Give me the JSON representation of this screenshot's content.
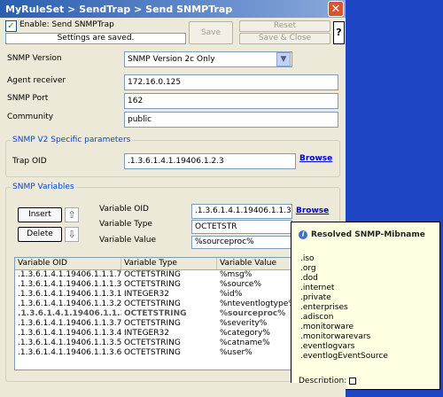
{
  "window": {
    "title": "MyRuleSet > SendTrap > Send SNMPTrap",
    "close_glyph": "✕"
  },
  "toolbar": {
    "enable_label": "Enable: Send SNMPTrap",
    "status": "Settings are saved.",
    "save_label": "Save",
    "reset_label": "Reset",
    "save_close_label": "Save & Close",
    "help_glyph": "?"
  },
  "form": {
    "version_label": "SNMP Version",
    "version_value": "SNMP Version 2c Only",
    "agent_label": "Agent receiver",
    "agent_value": "172.16.0.125",
    "port_label": "SNMP Port",
    "port_value": "162",
    "community_label": "Community",
    "community_value": "public"
  },
  "v2": {
    "group_title": "SNMP V2 Specific parameters",
    "trap_oid_label": "Trap OID",
    "trap_oid_value": ".1.3.6.1.4.1.19406.1.2.3",
    "browse_label": "Browse"
  },
  "variables": {
    "group_title": "SNMP Variables",
    "insert_label": "Insert",
    "delete_label": "Delete",
    "up_glyph": "⇧",
    "down_glyph": "⇩",
    "oid_label": "Variable OID",
    "oid_value": ".1.3.6.1.4.1.19406.1.1.3.3",
    "browse_label": "Browse",
    "type_label": "Variable Type",
    "type_value": "OCTETSTR",
    "value_label": "Variable Value",
    "value_value": "%sourceproc%"
  },
  "table": {
    "headers": [
      "Variable OID",
      "Variable Type",
      "Variable Value"
    ],
    "rows": [
      [
        ".1.3.6.1.4.1.19406.1.1.1.7",
        "OCTETSTRING",
        "%msg%"
      ],
      [
        ".1.3.6.1.4.1.19406.1.1.1.3",
        "OCTETSTRING",
        "%source%"
      ],
      [
        ".1.3.6.1.4.1.19406.1.1.3.1",
        "INTEGER32",
        "%id%"
      ],
      [
        ".1.3.6.1.4.1.19406.1.1.3.2",
        "OCTETSTRING",
        "%nteventlogtype%"
      ],
      [
        ".1.3.6.1.4.1.19406.1.1.3.3",
        "OCTETSTRING",
        "%sourceproc%"
      ],
      [
        ".1.3.6.1.4.1.19406.1.1.3.7",
        "OCTETSTRING",
        "%severity%"
      ],
      [
        ".1.3.6.1.4.1.19406.1.1.3.4",
        "INTEGER32",
        "%category%"
      ],
      [
        ".1.3.6.1.4.1.19406.1.1.3.5",
        "OCTETSTRING",
        "%catname%"
      ],
      [
        ".1.3.6.1.4.1.19406.1.1.3.6",
        "OCTETSTRING",
        "%user%"
      ]
    ],
    "selected_row": 4
  },
  "tooltip": {
    "title": "Resolved SNMP-Mibname",
    "icon": "info-icon",
    "items": [
      ".iso",
      ".org",
      ".dod",
      ".internet",
      ".private",
      ".enterprises",
      ".adiscon",
      ".monitorware",
      ".monitorwarevars",
      ".eventlogvars",
      ".eventlogEventSource"
    ],
    "description_label": "Description:"
  },
  "colors": {
    "titlebar": "#2a5fb0",
    "group_title": "#0046d5",
    "link": "#0000cc",
    "tooltip_bg": "#ffffe1"
  }
}
